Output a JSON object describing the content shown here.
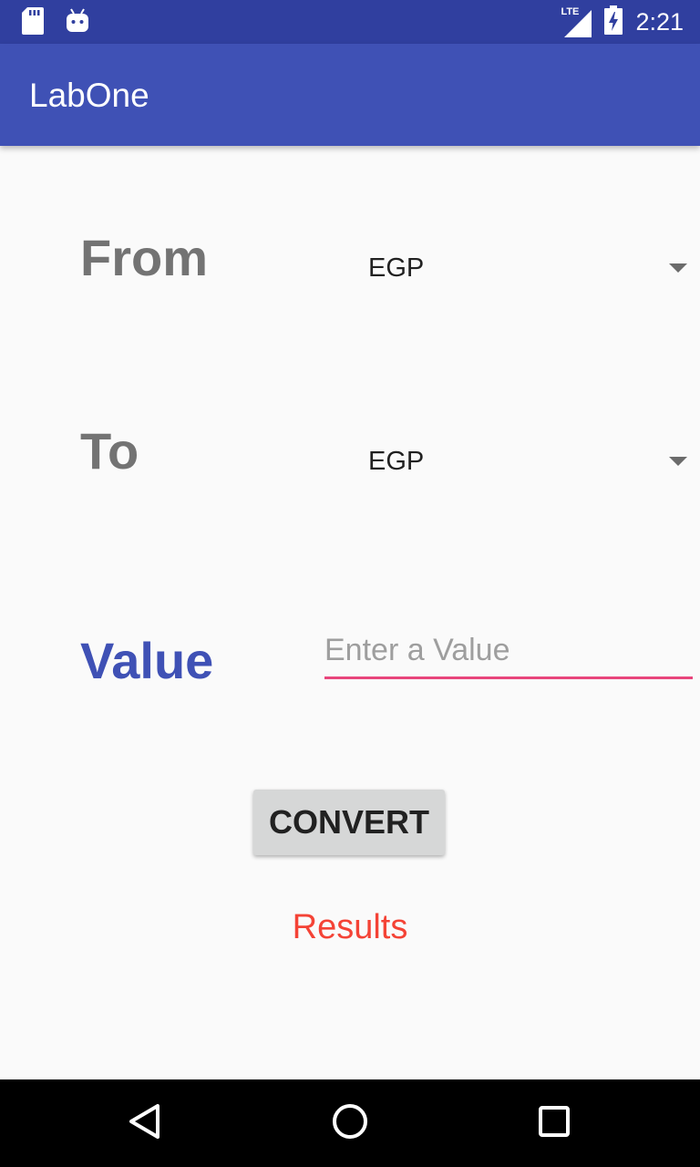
{
  "status_bar": {
    "time": "2:21",
    "network_label": "LTE",
    "icons": [
      "sd-card-icon",
      "android-icon",
      "signal-icon",
      "battery-charging-icon"
    ]
  },
  "app_bar": {
    "title": "LabOne"
  },
  "form": {
    "from_label": "From",
    "from_value": "EGP",
    "to_label": "To",
    "to_value": "EGP",
    "value_label": "Value",
    "value_placeholder": "Enter a Value",
    "value_text": "",
    "convert_label": "CONVERT",
    "results_text": "Results"
  },
  "nav_bar": {
    "icons": [
      "back-icon",
      "home-icon",
      "recents-icon"
    ]
  },
  "colors": {
    "primary_dark": "#303f9f",
    "primary": "#3f51b5",
    "accent": "#e8457c",
    "results": "#f44336",
    "label_gray": "#737373"
  }
}
